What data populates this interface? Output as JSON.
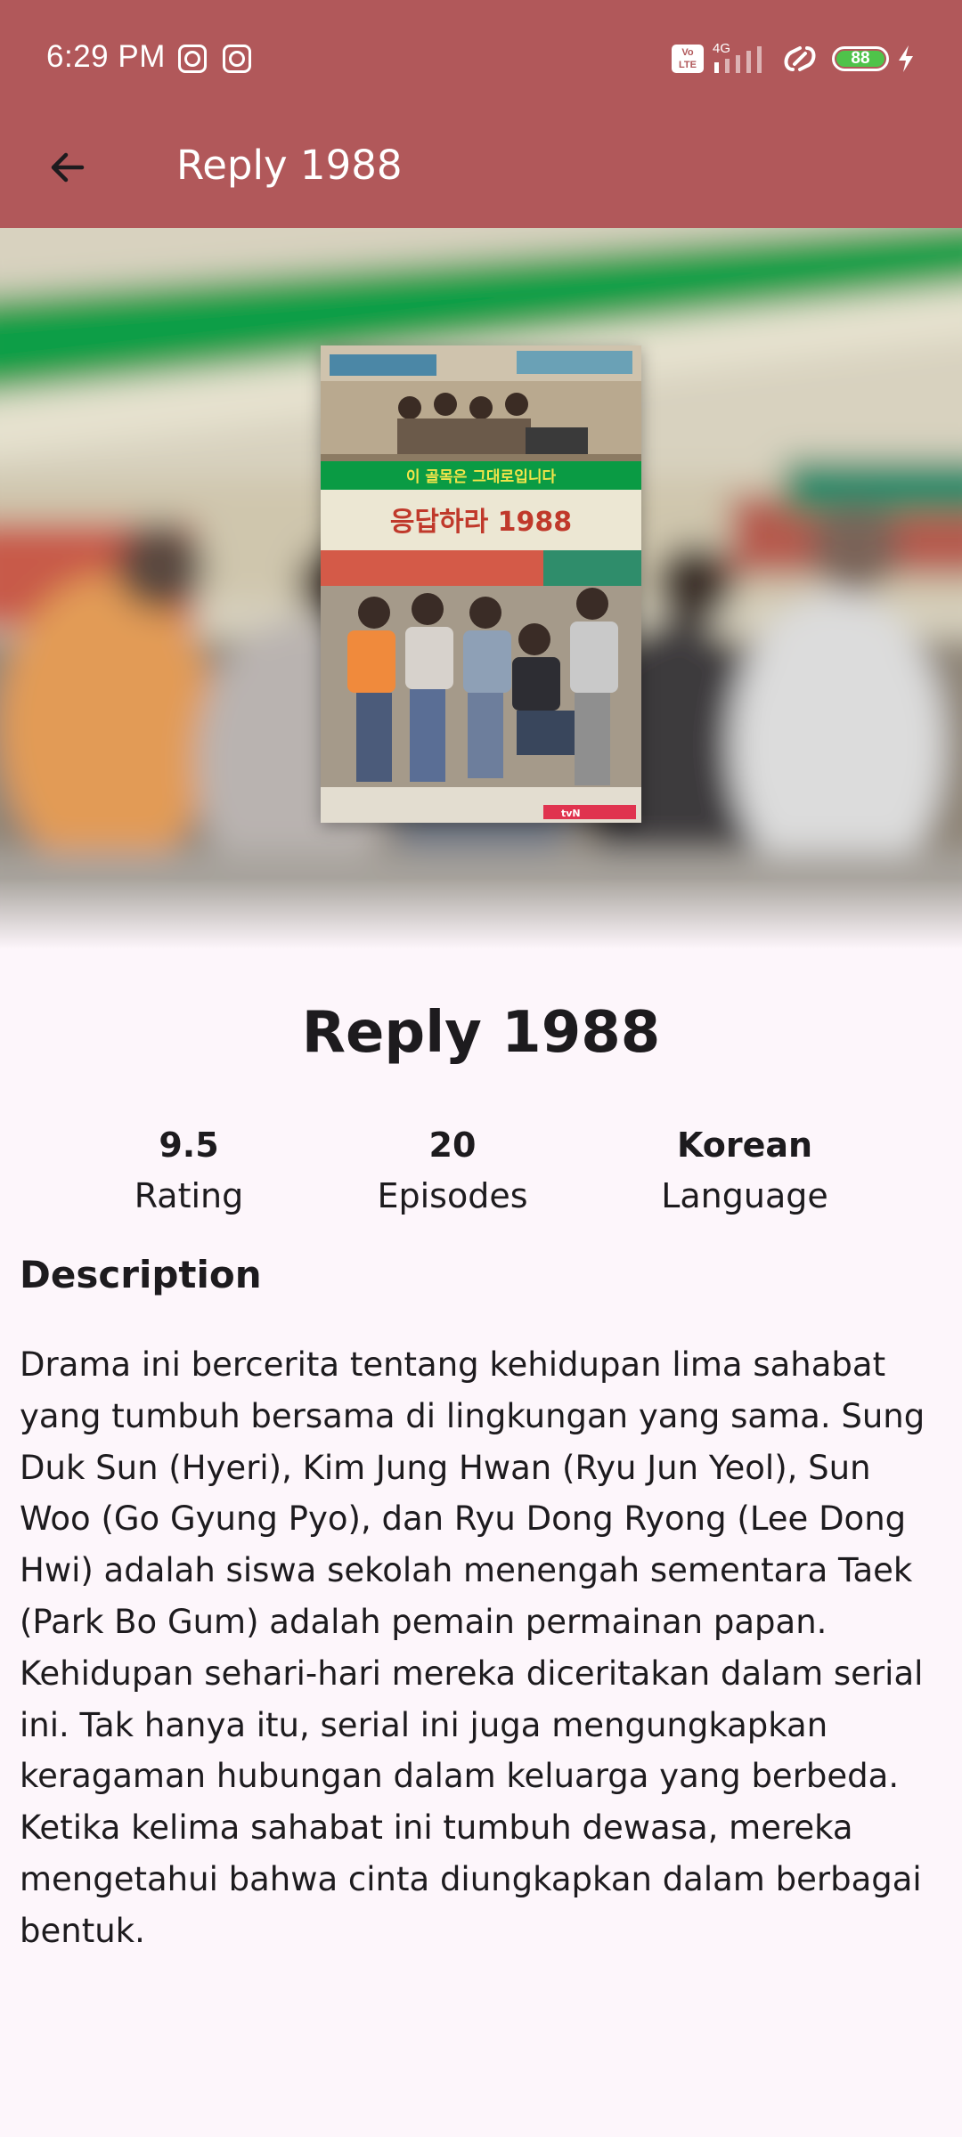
{
  "status_bar": {
    "time": "6:29 PM",
    "network": "4G",
    "volte": "Vo LTE",
    "battery": "88",
    "icons": [
      "notification-icon",
      "notification-icon",
      "volte-icon",
      "signal-icon",
      "link-icon",
      "battery-icon",
      "charging-icon"
    ]
  },
  "app_bar": {
    "back_icon": "arrow-back-icon",
    "title": "Reply 1988"
  },
  "colors": {
    "app_bar": "#b1585a",
    "background": "#fdf6fb",
    "text": "#1d1b1e",
    "battery": "#4fc34a"
  },
  "drama": {
    "title": "Reply 1988",
    "stats": [
      {
        "value": "9.5",
        "label": "Rating"
      },
      {
        "value": "20",
        "label": "Episodes"
      },
      {
        "value": "Korean",
        "label": "Language"
      }
    ],
    "description_heading": "Description",
    "description": "Drama ini bercerita tentang kehidupan lima sahabat yang tumbuh bersama di lingkungan yang sama. Sung Duk Sun (Hyeri), Kim Jung Hwan (Ryu Jun Yeol), Sun Woo (Go Gyung Pyo), dan Ryu Dong Ryong (Lee Dong Hwi) adalah siswa sekolah menengah sementara Taek (Park Bo Gum) adalah pemain permainan papan. Kehidupan sehari-hari mereka diceritakan dalam serial ini. Tak hanya itu, serial ini juga mengungkapkan keragaman hubungan dalam keluarga yang berbeda. Ketika kelima sahabat ini tumbuh dewasa, mereka mengetahui bahwa cinta diungkapkan dalam berbagai bentuk."
  },
  "poster": {
    "banner_text": "이 골목은 그대로입니다",
    "logo_text": "응답하라 1988",
    "channel": "tvN"
  }
}
